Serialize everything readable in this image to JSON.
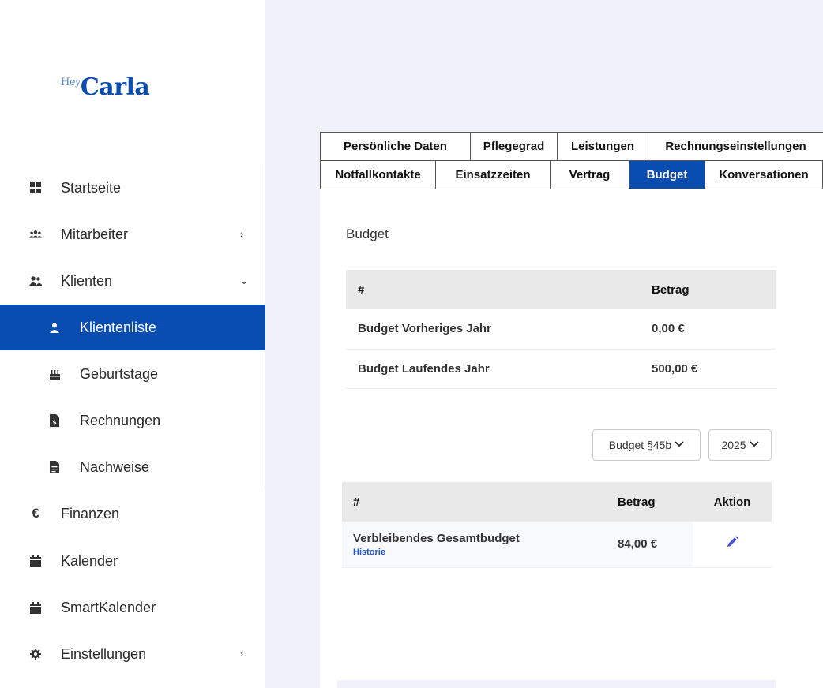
{
  "logo": {
    "hey": "Hey",
    "carla": "Carla"
  },
  "sidebar": {
    "items": [
      {
        "label": "Startseite",
        "icon": "dashboard-icon"
      },
      {
        "label": "Mitarbeiter",
        "icon": "users-icon",
        "chevron": "›"
      },
      {
        "label": "Klienten",
        "icon": "clients-icon",
        "chevron": "⌄"
      },
      {
        "label": "Klientenliste",
        "icon": "user-icon",
        "active": true
      },
      {
        "label": "Geburtstage",
        "icon": "cake-icon"
      },
      {
        "label": "Rechnungen",
        "icon": "invoice-icon"
      },
      {
        "label": "Nachweise",
        "icon": "document-icon"
      },
      {
        "label": "Finanzen",
        "icon": "euro-icon",
        "glyph": "€"
      },
      {
        "label": "Kalender",
        "icon": "calendar-icon"
      },
      {
        "label": "SmartKalender",
        "icon": "calendar-icon"
      },
      {
        "label": "Einstellungen",
        "icon": "gear-icon",
        "chevron": "›"
      }
    ]
  },
  "tabs": {
    "row1": [
      "Persönliche Daten",
      "Pflegegrad",
      "Leistungen",
      "Rechnungseinstellungen"
    ],
    "row2": [
      "Notfallkontakte",
      "Einsatzzeiten",
      "Vertrag",
      "Budget",
      "Konversationen"
    ],
    "active": "Budget"
  },
  "budget": {
    "title": "Budget",
    "table1": {
      "headers": [
        "#",
        "Betrag"
      ],
      "rows": [
        [
          "Budget Vorheriges Jahr",
          "0,00 €"
        ],
        [
          "Budget Laufendes Jahr",
          "500,00 €"
        ]
      ]
    },
    "filters": {
      "budget_type": "Budget §45b",
      "year": "2025"
    },
    "table2": {
      "headers": [
        "#",
        "Betrag",
        "Aktion"
      ],
      "row": {
        "label": "Verbleibendes Gesamtbudget",
        "link": "Historie",
        "amount": "84,00 €"
      }
    }
  },
  "colors": {
    "accent": "#0a4db0",
    "action": "#4b55d8"
  }
}
